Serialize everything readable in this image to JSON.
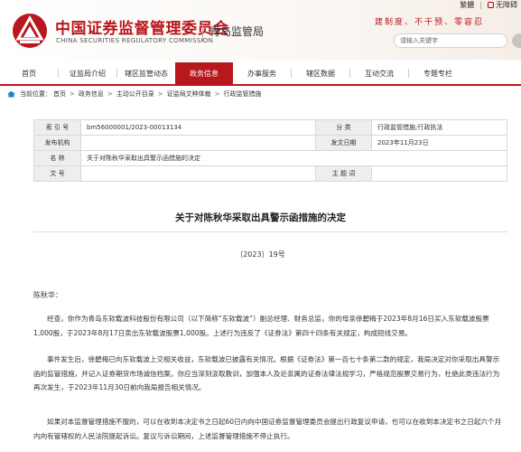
{
  "topbar": {
    "traditional": "繁體",
    "sep": "|",
    "accessibility": "无障碍"
  },
  "header": {
    "org_name_cn": "中国证券监督管理委员会",
    "org_name_en": "CHINA SECURITIES REGULATORY COMMISSION",
    "bureau": "青岛监管局",
    "slogan": "建制度、不干预、零容忍",
    "search_placeholder": "请输入关键字",
    "brand_color": "#b8171d"
  },
  "nav": {
    "items": [
      {
        "label": "首页"
      },
      {
        "label": "证监局介绍"
      },
      {
        "label": "辖区监管动态"
      },
      {
        "label": "政务信息",
        "active": true
      },
      {
        "label": "办事服务"
      },
      {
        "label": "辖区数据"
      },
      {
        "label": "互动交流"
      },
      {
        "label": "专题专栏"
      }
    ]
  },
  "breadcrumb": {
    "prefix": "当前位置：",
    "items": [
      "首页",
      "政务信息",
      "主动公开目录",
      "证监局文种体裁",
      "行政监管措施"
    ],
    "sep": ">"
  },
  "info": {
    "index_label": "索 引 号",
    "index_value": "bm56000001/2023-00013134",
    "category_label": "分 类",
    "category_value": "行政监管措施;行政执法",
    "issuer_label": "发布机构",
    "issuer_value": "",
    "date_label": "发文日期",
    "date_value": "2023年11月23日",
    "name_label": "名 称",
    "name_value": "关于对陈秋华采取出具警示函措施的决定",
    "docno_label": "文 号",
    "docno_value": "",
    "topic_label": "主 题 词",
    "topic_value": ""
  },
  "document": {
    "title": "关于对陈秋华采取出具警示函措施的决定",
    "number": "〔2023〕19号",
    "salutation": "陈秋华：",
    "paragraphs": [
      [
        "经查，你作为青岛东软载波科技股份有限公司（以下简称“东软载波”）副总经理、财务总监，你的母亲徐碧梅于2023年8月16日买入东软载波股票",
        "1,000股，于2023年8月17日卖出东软载波股票1,000股。上述行为违反了《证券法》第四十四条有关规定，构成短线交易。"
      ],
      [
        "事件发生后，徐碧梅已向东软载波上交相关收益，东软载波已披露有关情况。根据《证券法》第一百七十条第二款的规定，我局决定对你采取出具警示",
        "函的监管措施，并记入证券期货市场诚信档案。你应当深刻汲取教训，加强本人及近亲属的证券法律法规学习，严格规范股票交易行为，杜绝此类违法行为",
        "再次发生，于2023年11月30日前向我局报告相关情况。"
      ],
      [
        "如果对本监督管理措施不服的，可以在收到本决定书之日起60日内向中国证券监督管理委员会提出行政复议申请，也可以在收到本决定书之日起六个月",
        "内向有管辖权的人民法院提起诉讼。复议与诉讼期间，上述监督管理措施不停止执行。"
      ]
    ]
  }
}
